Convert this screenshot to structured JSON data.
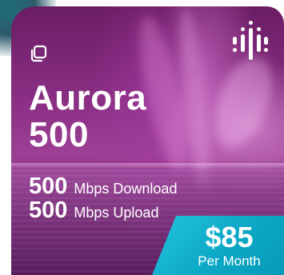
{
  "plan": {
    "name_line1": "Aurora",
    "name_line2": "500",
    "download": {
      "value": "500",
      "label": "Mbps Download"
    },
    "upload": {
      "value": "500",
      "label": "Mbps Upload"
    }
  },
  "price": {
    "amount": "$85",
    "period": "Per Month"
  },
  "icons": {
    "top_left": "copy-icon",
    "top_right": "brand-logo-icon"
  },
  "colors": {
    "card_purple": "#8a2f84",
    "price_teal": "#0aa6c4",
    "text": "#ffffff"
  }
}
